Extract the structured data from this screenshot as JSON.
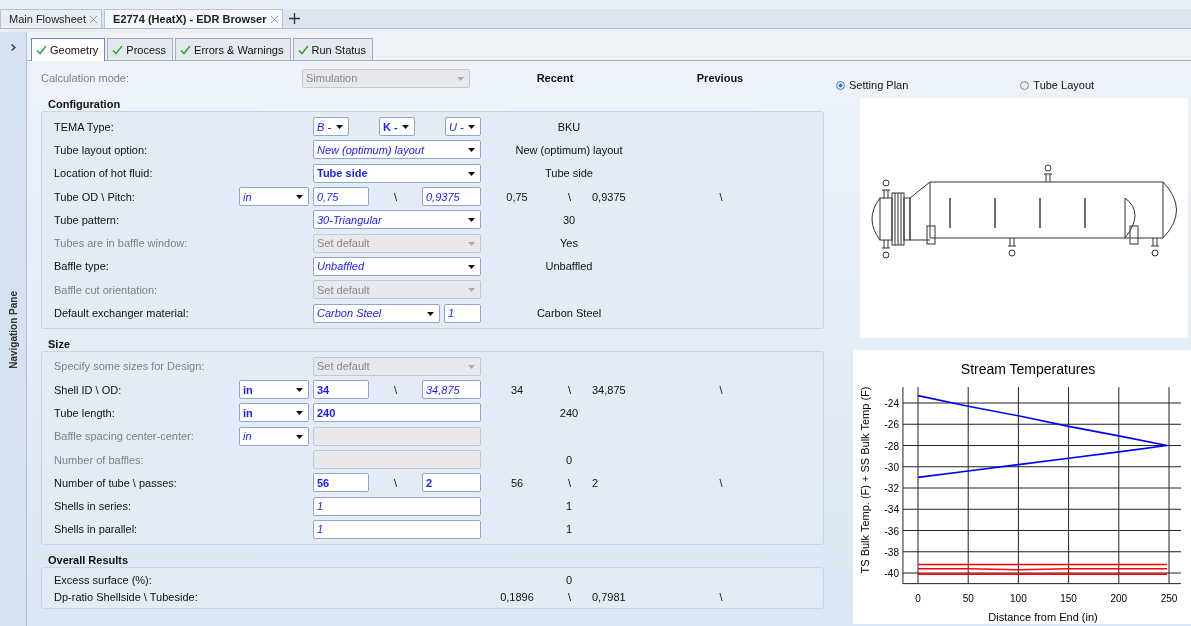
{
  "document_tabs": [
    {
      "label": "Main Flowsheet",
      "selected": false
    },
    {
      "label": "E2774 (HeatX) - EDR Browser",
      "selected": true
    }
  ],
  "navigation_pane": {
    "label": "Navigation Pane"
  },
  "tabs": [
    {
      "label": "Geometry",
      "selected": true,
      "checked": true
    },
    {
      "label": "Process",
      "selected": false,
      "checked": true
    },
    {
      "label": "Errors & Warnings",
      "selected": false,
      "checked": true
    },
    {
      "label": "Run Status",
      "selected": false,
      "checked": true
    }
  ],
  "calculation_mode": {
    "label": "Calculation mode:",
    "value": "Simulation",
    "disabled": true
  },
  "columns": {
    "recent": "Recent",
    "previous": "Previous"
  },
  "sections": [
    {
      "title": "Configuration",
      "rows": [
        {
          "label": "TEMA Type:",
          "disabled": false,
          "kind": "tema",
          "fields": [
            {
              "kind": "dropdown",
              "value": "B -",
              "user_input": false,
              "disabled": false
            },
            {
              "kind": "dropdown",
              "value": "K -",
              "user_input": true,
              "disabled": false
            },
            {
              "kind": "dropdown",
              "value": "U -",
              "user_input": false,
              "disabled": false
            }
          ],
          "recent": [
            "BKU"
          ]
        },
        {
          "label": "Tube layout option:",
          "disabled": false,
          "kind": "wide",
          "fields": [
            {
              "kind": "dropdown",
              "value": "New (optimum) layout",
              "user_input": false,
              "disabled": false
            }
          ],
          "recent": [
            "New (optimum) layout"
          ]
        },
        {
          "label": "Location of hot fluid:",
          "disabled": false,
          "kind": "wide",
          "fields": [
            {
              "kind": "dropdown",
              "value": "Tube side",
              "user_input": true,
              "disabled": false
            }
          ],
          "recent": [
            "Tube side"
          ]
        },
        {
          "label": "Tube OD \\ Pitch:",
          "disabled": false,
          "kind": "pair",
          "unit": {
            "value": "in",
            "user_input": false,
            "disabled": false
          },
          "fields": [
            {
              "kind": "text",
              "value": "0,75",
              "user_input": false,
              "disabled": false
            },
            {
              "kind": "text",
              "value": "0,9375",
              "user_input": false,
              "disabled": false
            }
          ],
          "separator": "\\",
          "recent": [
            "0,75",
            "\\",
            "0,9375"
          ],
          "previous": [
            "\\"
          ]
        },
        {
          "label": "Tube pattern:",
          "disabled": false,
          "kind": "wide",
          "fields": [
            {
              "kind": "dropdown",
              "value": "30-Triangular",
              "user_input": false,
              "disabled": false
            }
          ],
          "recent": [
            "30"
          ]
        },
        {
          "label": "Tubes are in baffle window:",
          "disabled": true,
          "kind": "wide",
          "fields": [
            {
              "kind": "dropdown",
              "value": "Set default",
              "user_input": false,
              "disabled": true
            }
          ],
          "recent": [
            "Yes"
          ]
        },
        {
          "label": "Baffle type:",
          "disabled": false,
          "kind": "wide",
          "fields": [
            {
              "kind": "dropdown",
              "value": "Unbaffled",
              "user_input": false,
              "disabled": false
            }
          ],
          "recent": [
            "Unbaffled"
          ]
        },
        {
          "label": "Baffle cut orientation:",
          "disabled": true,
          "kind": "wide",
          "fields": [
            {
              "kind": "dropdown",
              "value": "Set default",
              "user_input": false,
              "disabled": true
            }
          ]
        },
        {
          "label": "Default exchanger material:",
          "disabled": false,
          "kind": "material",
          "fields": [
            {
              "kind": "dropdown",
              "value": "Carbon Steel",
              "user_input": false,
              "disabled": false
            },
            {
              "kind": "text",
              "value": "1",
              "user_input": false,
              "disabled": false
            }
          ],
          "recent": [
            "Carbon Steel"
          ]
        }
      ]
    },
    {
      "title": "Size",
      "rows": [
        {
          "label": "Specify some sizes for Design:",
          "disabled": true,
          "kind": "wide",
          "fields": [
            {
              "kind": "dropdown",
              "value": "Set default",
              "user_input": false,
              "disabled": true
            }
          ]
        },
        {
          "label": "Shell ID \\ OD:",
          "disabled": false,
          "kind": "pair",
          "unit": {
            "value": "in",
            "user_input": true,
            "disabled": false
          },
          "fields": [
            {
              "kind": "text",
              "value": "34",
              "user_input": true,
              "disabled": false
            },
            {
              "kind": "text",
              "value": "34,875",
              "user_input": false,
              "disabled": false
            }
          ],
          "separator": "\\",
          "recent": [
            "34",
            "\\",
            "34,875"
          ],
          "previous": [
            "\\"
          ]
        },
        {
          "label": "Tube length:",
          "disabled": false,
          "kind": "wide",
          "unit": {
            "value": "in",
            "user_input": true,
            "disabled": false
          },
          "fields": [
            {
              "kind": "text",
              "value": "240",
              "user_input": true,
              "disabled": false
            }
          ],
          "recent": [
            "240"
          ]
        },
        {
          "label": "Baffle spacing center-center:",
          "disabled": true,
          "kind": "wide",
          "unit": {
            "value": "in",
            "user_input": false,
            "disabled": false
          },
          "fields": [
            {
              "kind": "text",
              "disabled": true
            }
          ]
        },
        {
          "label": "Number of baffles:",
          "disabled": true,
          "kind": "wide",
          "fields": [
            {
              "kind": "text",
              "disabled": true
            }
          ],
          "recent": [
            "0"
          ]
        },
        {
          "label": "Number of tube \\ passes:",
          "disabled": false,
          "kind": "pair",
          "fields": [
            {
              "kind": "text",
              "value": "56",
              "user_input": true,
              "disabled": false
            },
            {
              "kind": "text",
              "value": "2",
              "user_input": true,
              "disabled": false
            }
          ],
          "separator": "\\",
          "recent": [
            "56",
            "\\",
            "2"
          ],
          "previous": [
            "\\"
          ]
        },
        {
          "label": "Shells in series:",
          "disabled": false,
          "kind": "wide",
          "fields": [
            {
              "kind": "text",
              "value": "1",
              "user_input": false,
              "disabled": false
            }
          ],
          "recent": [
            "1"
          ]
        },
        {
          "label": "Shells in parallel:",
          "disabled": false,
          "kind": "wide",
          "fields": [
            {
              "kind": "text",
              "value": "1",
              "user_input": false,
              "disabled": false
            }
          ],
          "recent": [
            "1"
          ]
        }
      ]
    },
    {
      "title": "Overall Results",
      "rows": [
        {
          "label": "Excess surface (%):",
          "disabled": false,
          "kind": "none",
          "recent": [
            "0"
          ]
        },
        {
          "label": "Dp-ratio Shellside \\ Tubeside:",
          "disabled": false,
          "kind": "none",
          "recent": [
            "0,1896",
            "\\",
            "0,7981"
          ],
          "previous": [
            "\\"
          ]
        }
      ]
    }
  ],
  "views": [
    {
      "label": "Setting Plan",
      "selected": true
    },
    {
      "label": "Tube Layout",
      "selected": false
    }
  ],
  "chart": {
    "chart_data": {
      "type": "line",
      "title": "Stream Temperatures",
      "xlabel": "Distance from End (in)",
      "ylabel": "TS Bulk Temp. (F) + SS Bulk Temp (F)",
      "grid": true,
      "x": [
        0,
        50,
        100,
        150,
        200,
        248
      ],
      "series": [
        {
          "color": "#0000ff",
          "values": [
            -23.3,
            -24.3,
            -25.2,
            -26.2,
            -27.1,
            -28.0
          ]
        },
        {
          "color": "#0000ff",
          "values": [
            -31.0,
            -30.4,
            -29.8,
            -29.2,
            -28.6,
            -28.0
          ]
        },
        {
          "color": "#ff0000",
          "values": [
            -39.2,
            -39.2,
            -39.2,
            -39.2,
            -39.2,
            -39.2
          ]
        },
        {
          "color": "#ff0000",
          "values": [
            -39.6,
            -39.6,
            -39.7,
            -39.6,
            -39.6,
            -39.6
          ]
        },
        {
          "color": "#ff0000",
          "values": [
            -40.1,
            -40.1,
            -40.1,
            -40.1,
            -40.1,
            -40.1
          ]
        }
      ],
      "xlim": [
        -15,
        262
      ],
      "ylim": [
        -41,
        -22.5
      ],
      "xticks": [
        0,
        50,
        100,
        150,
        200,
        250
      ],
      "yticks": [
        -24,
        -26,
        -28,
        -30,
        -32,
        -34,
        -36,
        -38,
        -40
      ]
    }
  }
}
